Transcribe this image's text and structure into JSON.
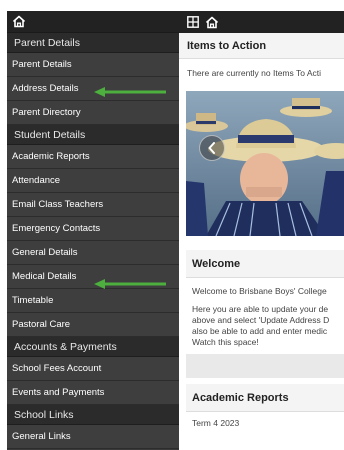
{
  "sidebar": {
    "home_icon": "home-icon",
    "items": [
      {
        "type": "section",
        "name": "section-parent-details",
        "label": "Parent Details"
      },
      {
        "type": "item",
        "name": "sidebar-item-parent-details",
        "label": "Parent Details"
      },
      {
        "type": "item",
        "name": "sidebar-item-address-details",
        "label": "Address Details"
      },
      {
        "type": "item",
        "name": "sidebar-item-parent-directory",
        "label": "Parent Directory"
      },
      {
        "type": "section",
        "name": "section-student-details",
        "label": "Student Details"
      },
      {
        "type": "item",
        "name": "sidebar-item-academic-reports",
        "label": "Academic Reports"
      },
      {
        "type": "item",
        "name": "sidebar-item-attendance",
        "label": "Attendance"
      },
      {
        "type": "item",
        "name": "sidebar-item-email-class-teachers",
        "label": "Email Class Teachers"
      },
      {
        "type": "item",
        "name": "sidebar-item-emergency-contacts",
        "label": "Emergency Contacts"
      },
      {
        "type": "item",
        "name": "sidebar-item-general-details",
        "label": "General Details"
      },
      {
        "type": "item",
        "name": "sidebar-item-medical-details",
        "label": "Medical Details"
      },
      {
        "type": "item",
        "name": "sidebar-item-timetable",
        "label": "Timetable"
      },
      {
        "type": "item",
        "name": "sidebar-item-pastoral-care",
        "label": "Pastoral Care"
      },
      {
        "type": "section",
        "name": "section-accounts-payments",
        "label": "Accounts & Payments"
      },
      {
        "type": "item",
        "name": "sidebar-item-school-fees-account",
        "label": "School Fees Account"
      },
      {
        "type": "item",
        "name": "sidebar-item-events-and-payments",
        "label": "Events and Payments"
      },
      {
        "type": "section",
        "name": "section-school-links",
        "label": "School Links"
      },
      {
        "type": "item",
        "name": "sidebar-item-general-links",
        "label": "General Links"
      }
    ]
  },
  "topbar": {
    "grid_icon": "grid-icon",
    "home_icon": "home-icon"
  },
  "main": {
    "items_to_action": {
      "title": "Items to Action",
      "text": "There are currently no Items To Acti"
    },
    "carousel": {
      "prev_icon": "chevron-left-icon"
    },
    "welcome": {
      "title": "Welcome",
      "intro": "Welcome to Brisbane Boys' College",
      "body_lines": [
        "Here you are able to update your de",
        "above and select 'Update Address D",
        "also be able to add and enter medic",
        "Watch this space!"
      ]
    },
    "academic_reports": {
      "title": "Academic Reports",
      "term": "Term 4 2023"
    }
  },
  "annotations": {
    "arrow_color": "#4caf3e",
    "arrow_targets": [
      "Address Details",
      "Medical Details"
    ]
  }
}
